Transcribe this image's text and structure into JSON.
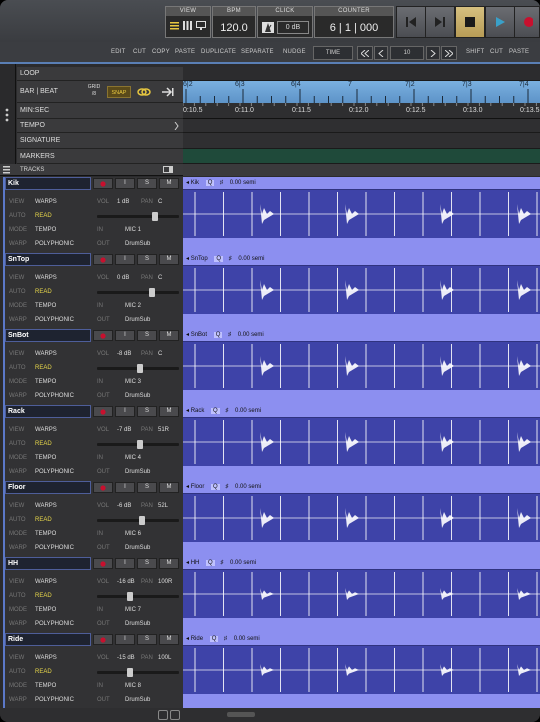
{
  "transport": {
    "view_label": "VIEW",
    "bpm_label": "BPM",
    "bpm_value": "120.0",
    "click_label": "CLICK",
    "click_value": "0 dB",
    "counter_label": "COUNTER",
    "counter_value": "6 | 1 | 000"
  },
  "toolbar": {
    "edit": "EDIT",
    "cut": "CUT",
    "copy": "COPY",
    "paste": "PASTE",
    "duplicate": "DUPLICATE",
    "separate": "SEPARATE",
    "nudge": "NUDGE",
    "nudge_mode": "TIME",
    "nudge_value": "10",
    "shift": "SHIFT",
    "cut2": "CUT",
    "paste2": "PASTE"
  },
  "rulers": {
    "loop": "LOOP",
    "bar_beat": "BAR | BEAT",
    "grid_label": "GRID",
    "grid_value": "/8",
    "snap": "SNAP",
    "min_sec": "MIN:SEC",
    "tempo": "TEMPO",
    "signature": "SIGNATURE",
    "markers": "MARKERS",
    "tracks": "TRACKS",
    "bar_ticks": [
      "6|2",
      "6|3",
      "6|4",
      "7",
      "7|2",
      "7|3",
      "7|4"
    ],
    "time_ticks": [
      "0:10.5",
      "0:11.0",
      "0:11.5",
      "0:12.0",
      "0:12.5",
      "0:13.0",
      "0:13.5"
    ]
  },
  "row_labels": {
    "view": "VIEW",
    "auto": "AUTO",
    "mode": "MODE",
    "warp": "WARP",
    "vol": "VOL",
    "pan": "PAN",
    "in": "IN",
    "out": "OUT",
    "warps": "WARPS",
    "read": "READ",
    "tempo": "TEMPO",
    "polyphonic": "POLYPHONIC",
    "btn_i": "I",
    "btn_s": "S",
    "btn_m": "M",
    "q": "Q",
    "semi": "0.00 semi"
  },
  "tracks": [
    {
      "name": "Kik",
      "vol": "1 dB",
      "pan": "C",
      "in": "MIC 1",
      "out": "DrumSub",
      "fader": 0.72
    },
    {
      "name": "SnTop",
      "vol": "0 dB",
      "pan": "C",
      "in": "MIC 2",
      "out": "DrumSub",
      "fader": 0.68
    },
    {
      "name": "SnBot",
      "vol": "-8 dB",
      "pan": "C",
      "in": "MIC 3",
      "out": "DrumSub",
      "fader": 0.52
    },
    {
      "name": "Rack",
      "vol": "-7 dB",
      "pan": "51R",
      "in": "MIC 4",
      "out": "DrumSub",
      "fader": 0.53
    },
    {
      "name": "Floor",
      "vol": "-6 dB",
      "pan": "52L",
      "in": "MIC 6",
      "out": "DrumSub",
      "fader": 0.55
    },
    {
      "name": "HH",
      "vol": "-16 dB",
      "pan": "100R",
      "in": "MIC 7",
      "out": "DrumSub",
      "fader": 0.39
    },
    {
      "name": "Ride",
      "vol": "-15 dB",
      "pan": "100L",
      "in": "MIC 8",
      "out": "DrumSub",
      "fader": 0.4
    }
  ],
  "colors": {
    "accent": "#5b78c8",
    "clip": "#8c8ff0",
    "wave_bg": "#3e43a8",
    "read": "#e8d84a",
    "play": "#3aa0c8",
    "stop": "#c8b070",
    "record": "#c8102e"
  },
  "icons": [
    "menu-icon",
    "view-lines-icon",
    "monitor-icon",
    "metronome-icon",
    "rewind-icon",
    "fast-forward-icon",
    "stop-icon",
    "play-icon",
    "record-icon",
    "link-icon",
    "arrow-right-icon",
    "double-left-icon",
    "left-icon",
    "right-icon",
    "double-right-icon",
    "chevron-right-icon",
    "dots-icon"
  ]
}
